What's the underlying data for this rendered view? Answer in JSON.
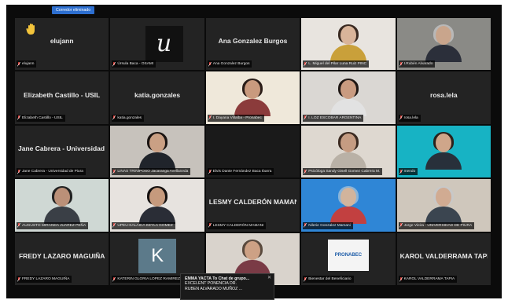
{
  "banner": {
    "text": "Corredor eliminado"
  },
  "tiles": [
    {
      "center": "elujann",
      "tag": "elujann",
      "bg": "#232323",
      "icon": "raised-hand-icon"
    },
    {
      "center": "",
      "tag": "Úrsula Baca - OSAMI",
      "bg": "#232323",
      "logo": "u"
    },
    {
      "center": "Ana Gonzalez Burgos",
      "tag": "Ana Gonzalez Burgos",
      "bg": "#232323"
    },
    {
      "center": "",
      "tag": "L. Miguel del Pilar Luna Ruiz PINC",
      "bg": "#e8e4df",
      "person": {
        "skin": "#d9b49a",
        "hair": "#3a2a22",
        "body": "#c9a03a"
      }
    },
    {
      "center": "",
      "tag": "I.Rubén Alvarado",
      "bg": "#8a8a86",
      "person": {
        "skin": "#c9a58c",
        "hair": "#b8b8b8",
        "body": "#2b2f3a"
      }
    },
    {
      "center": "Elizabeth Castillo - USIL",
      "tag": "Elizabeth Castillo - USIL",
      "bg": "#232323"
    },
    {
      "center": "katia.gonzales",
      "tag": "katia.gonzales",
      "bg": "#232323"
    },
    {
      "center": "",
      "tag": "I. Dayana Villalba - Pronabec",
      "bg": "#efe8da",
      "person": {
        "skin": "#c99a7e",
        "hair": "#2a1d18",
        "body": "#8b3b3b"
      }
    },
    {
      "center": "",
      "tag": "I. LOZ ESCOBAR ARGENTINA",
      "bg": "#dad7d3",
      "person": {
        "skin": "#c99b80",
        "hair": "#1f1714",
        "body": "#e2e2e2"
      }
    },
    {
      "center": "rosa.lela",
      "tag": "rosa.lela",
      "bg": "#232323"
    },
    {
      "center": "Jane Cabrera - Universidad ...",
      "tag": "Jane Cabrera - Universidad de Piura",
      "bg": "#232323"
    },
    {
      "center": "",
      "tag": "LINAS TRINIPOSO Jacaranga Avellaneda",
      "bg": "#c7c2bc",
      "person": {
        "skin": "#caa084",
        "hair": "#1a1412",
        "body": "#20242b"
      }
    },
    {
      "center": "",
      "tag": "Elvis Dante Fernández Baca Ibarra",
      "bg": "#1a1a1a"
    },
    {
      "center": "",
      "tag": "Psicóloga Sandy Gisell Gomez Cabrera M.",
      "bg": "#ded8d0",
      "person": {
        "skin": "#c59c82",
        "hair": "#3b2a20",
        "body": "#b9b1a6"
      }
    },
    {
      "center": "",
      "tag": "mendo",
      "bg": "#17b3c4",
      "person": {
        "skin": "#cfa68a",
        "hair": "#2b211b",
        "body": "#28303a"
      }
    },
    {
      "center": "",
      "tag": "AUGUSTO MIRANDA JUAREZ PEÑA",
      "bg": "#cfd8d4",
      "person": {
        "skin": "#bb9078",
        "hair": "#222",
        "body": "#3a3f46"
      }
    },
    {
      "center": "",
      "tag": "UPEU-KALAICA KEYLA GOMEZ",
      "bg": "#e7e3df",
      "person": {
        "skin": "#c69a7d",
        "hair": "#151110",
        "body": "#2a2d36"
      }
    },
    {
      "center": "LESMY CALDERÓN MAMANI",
      "tag": "LESMY CALDERÓN MAMANI",
      "bg": "#232323"
    },
    {
      "center": "",
      "tag": "Nilerie Gonzalez Mamani",
      "bg": "#2f86d6",
      "person": {
        "skin": "#d2b49c",
        "hair": "#8ab4d8",
        "body": "#c24040"
      }
    },
    {
      "center": "",
      "tag": "Jorge Vieira - UNIVERSIDAD DE PIURA",
      "bg": "#cfc7bc",
      "person": {
        "skin": "#d1ab92",
        "hair": "#c8c8c8",
        "body": "#3b4550"
      }
    },
    {
      "center": "FREDY LAZARO MAGUIÑA",
      "tag": "FREDY LAZARO MAGUIÑA",
      "bg": "#232323"
    },
    {
      "center": "",
      "tag": "KATERIN GLORIA LOPEZ RAMIREZ",
      "bg": "#232323",
      "avatar": "K"
    },
    {
      "center": "",
      "tag": "",
      "bg": "#d9d3cc",
      "person": {
        "skin": "#cda185",
        "hair": "#5a4a3e",
        "body": "#7a3b46"
      }
    },
    {
      "center": "",
      "tag": "Bienestar del Beneficiario",
      "bg": "#232323",
      "pronabec": "PRONABEC"
    },
    {
      "center": "KAROL VALDERRAMA TAPIA",
      "tag": "KAROL VALDERRAMA TAPIA",
      "bg": "#232323"
    }
  ],
  "chat_popup": {
    "line1": "EMMA YACTA To Chat de grupo...",
    "line2": "EXCELENT PONENCIA DR.",
    "line3": "RUBEN ALVARADO MUÑOZ ..."
  },
  "colors": {
    "accent": "#2d6fd0",
    "mic_muted": "#e0413a"
  }
}
